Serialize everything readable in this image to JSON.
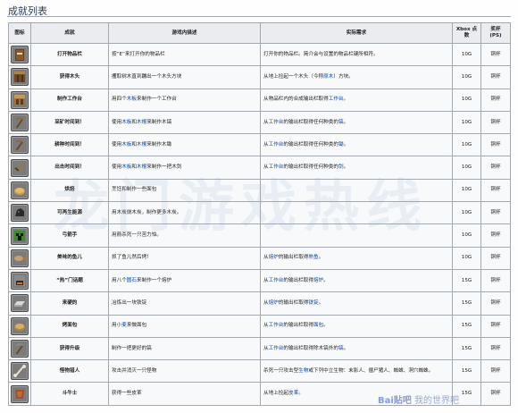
{
  "title": "成就列表",
  "headers": {
    "icon": "图标",
    "name": "成就",
    "desc": "游戏内描述",
    "req": "实际需求",
    "points": "Xbox 点数",
    "trophy": "奖杯 (PS)"
  },
  "rows": [
    {
      "icon": "book-icon",
      "name": "打开物品栏",
      "desc": [
        [
          "按“E”来打开你的物品栏",
          false
        ]
      ],
      "req": [
        [
          "打开你的物品栏。简介会与设置的物品栏键所相符。",
          false
        ]
      ],
      "points": "10G",
      "trophy": "铜杯"
    },
    {
      "icon": "log-icon",
      "name": "获得木头",
      "desc": [
        [
          "攫取树木直到蹦出一个木头方块",
          false
        ]
      ],
      "req": [
        [
          "从地上捡起一个木头（今称",
          false
        ],
        [
          "原木",
          true
        ],
        [
          "）方块。",
          false
        ]
      ],
      "points": "10G",
      "trophy": "铜杯"
    },
    {
      "icon": "crafting-table-icon",
      "name": "制作工作台",
      "desc": [
        [
          "用四个",
          false
        ],
        [
          "木板",
          true
        ],
        [
          "来制作一个工作台",
          false
        ]
      ],
      "req": [
        [
          "从物品栏内的合成输出栏取得",
          false
        ],
        [
          "工作台",
          true
        ],
        [
          "。",
          false
        ]
      ],
      "points": "10G",
      "trophy": "铜杯"
    },
    {
      "icon": "wooden-pickaxe-icon",
      "name": "采矿时间到！",
      "desc": [
        [
          "使用",
          false
        ],
        [
          "木板",
          true
        ],
        [
          "和",
          false
        ],
        [
          "木棍",
          true
        ],
        [
          "来制作木镐",
          false
        ]
      ],
      "req": [
        [
          "从",
          false
        ],
        [
          "工作台",
          true
        ],
        [
          "的输出栏取得任何种类的",
          false
        ],
        [
          "镐",
          true
        ],
        [
          "。",
          false
        ]
      ],
      "points": "10G",
      "trophy": "铜杯"
    },
    {
      "icon": "wooden-hoe-icon",
      "name": "耕种时间到！",
      "desc": [
        [
          "使用",
          false
        ],
        [
          "木板",
          true
        ],
        [
          "和",
          false
        ],
        [
          "木棍",
          true
        ],
        [
          "来制作木锄",
          false
        ]
      ],
      "req": [
        [
          "从",
          false
        ],
        [
          "工作台",
          true
        ],
        [
          "的输出栏取得任何种类的",
          false
        ],
        [
          "锄",
          true
        ],
        [
          "。",
          false
        ]
      ],
      "points": "10G",
      "trophy": "铜杯"
    },
    {
      "icon": "wooden-sword-icon",
      "name": "出击时间到！",
      "desc": [
        [
          "使用",
          false
        ],
        [
          "木板",
          true
        ],
        [
          "和",
          false
        ],
        [
          "木棍",
          true
        ],
        [
          "来制作一把木剑",
          false
        ]
      ],
      "req": [
        [
          "从",
          false
        ],
        [
          "工作台",
          true
        ],
        [
          "的输出栏取得任何种类的",
          false
        ],
        [
          "剑",
          true
        ],
        [
          "。",
          false
        ]
      ],
      "points": "10G",
      "trophy": "铜杯"
    },
    {
      "icon": "bread-icon",
      "name": "烘焙",
      "desc": [
        [
          "烹饪和制作一些面包",
          false
        ]
      ],
      "req": [
        [
          "",
          false
        ]
      ],
      "points": "10G",
      "trophy": "铜杯"
    },
    {
      "icon": "coal-icon",
      "name": "可再生能源",
      "desc": [
        [
          "用木炭烧木炭，制作更多木炭。",
          false
        ]
      ],
      "req": [
        [
          "",
          false
        ]
      ],
      "points": "10G",
      "trophy": "铜杯"
    },
    {
      "icon": "creeper-icon",
      "name": "弓箭手",
      "desc": [
        [
          "用箭杀死一只苦力怕。",
          false
        ]
      ],
      "req": [
        [
          "",
          false
        ]
      ],
      "points": "10G",
      "trophy": "铜杯"
    },
    {
      "icon": "cooked-fish-icon",
      "name": "美味的鱼儿",
      "desc": [
        [
          "抓了鱼儿然后烤！",
          false
        ]
      ],
      "req": [
        [
          "从",
          false
        ],
        [
          "熔炉",
          true
        ],
        [
          "的输出栏取得",
          false
        ],
        [
          "熟鱼",
          true
        ],
        [
          "。",
          false
        ]
      ],
      "points": "10G",
      "trophy": "铜杯"
    },
    {
      "icon": "furnace-icon",
      "name": "“热”门话题",
      "desc": [
        [
          "用八个",
          false
        ],
        [
          "圆石",
          true
        ],
        [
          "来制作一个熔炉",
          false
        ]
      ],
      "req": [
        [
          "从",
          false
        ],
        [
          "工作台",
          true
        ],
        [
          "的输出栏取得",
          false
        ],
        [
          "熔炉",
          true
        ],
        [
          "。",
          false
        ]
      ],
      "points": "15G",
      "trophy": "铜杯"
    },
    {
      "icon": "iron-ingot-icon",
      "name": "来硬的",
      "desc": [
        [
          "冶炼出一块铁锭",
          false
        ]
      ],
      "req": [
        [
          "从",
          false
        ],
        [
          "熔炉",
          true
        ],
        [
          "的输出栏取得",
          false
        ],
        [
          "铁锭",
          true
        ],
        [
          "。",
          false
        ]
      ],
      "points": "15G",
      "trophy": "铜杯"
    },
    {
      "icon": "cake-icon",
      "name": "烤面包",
      "desc": [
        [
          "用",
          false
        ],
        [
          "小麦",
          true
        ],
        [
          "来做面包",
          false
        ]
      ],
      "req": [
        [
          "从",
          false
        ],
        [
          "工作台",
          true
        ],
        [
          "的输出栏取得",
          false
        ],
        [
          "面包",
          true
        ],
        [
          "。",
          false
        ]
      ],
      "points": "15G",
      "trophy": "铜杯"
    },
    {
      "icon": "stone-pickaxe-icon",
      "name": "获得升级",
      "desc": [
        [
          "制作一把更好的镐",
          false
        ]
      ],
      "req": [
        [
          "从",
          false
        ],
        [
          "工作台",
          true
        ],
        [
          "的输出栏取得除木镐外的",
          false
        ],
        [
          "镐",
          true
        ],
        [
          "。",
          false
        ]
      ],
      "points": "15G",
      "trophy": "铜杯"
    },
    {
      "icon": "bone-icon",
      "name": "怪物猎人",
      "desc": [
        [
          "攻击并消灭一只怪物",
          false
        ]
      ],
      "req": [
        [
          "杀死一只攻击型",
          false
        ],
        [
          "生物",
          true
        ],
        [
          "或下列中立生物：末影人、僵尸猪人、蜘蛛、洞穴蜘蛛。",
          false
        ]
      ],
      "points": "15G",
      "trophy": "铜杯"
    },
    {
      "icon": "leather-icon",
      "name": "斗牛士",
      "desc": [
        [
          "获得一些皮革",
          false
        ]
      ],
      "req": [
        [
          "从地上捡起",
          false
        ],
        [
          "皮革",
          true
        ],
        [
          "。",
          false
        ]
      ],
      "points": "15G",
      "trophy": "铜杯"
    }
  ],
  "watermark": "龙门游戏热线",
  "baidu_logo": "Bai贴吧",
  "baidu_site": "我的世界吧"
}
